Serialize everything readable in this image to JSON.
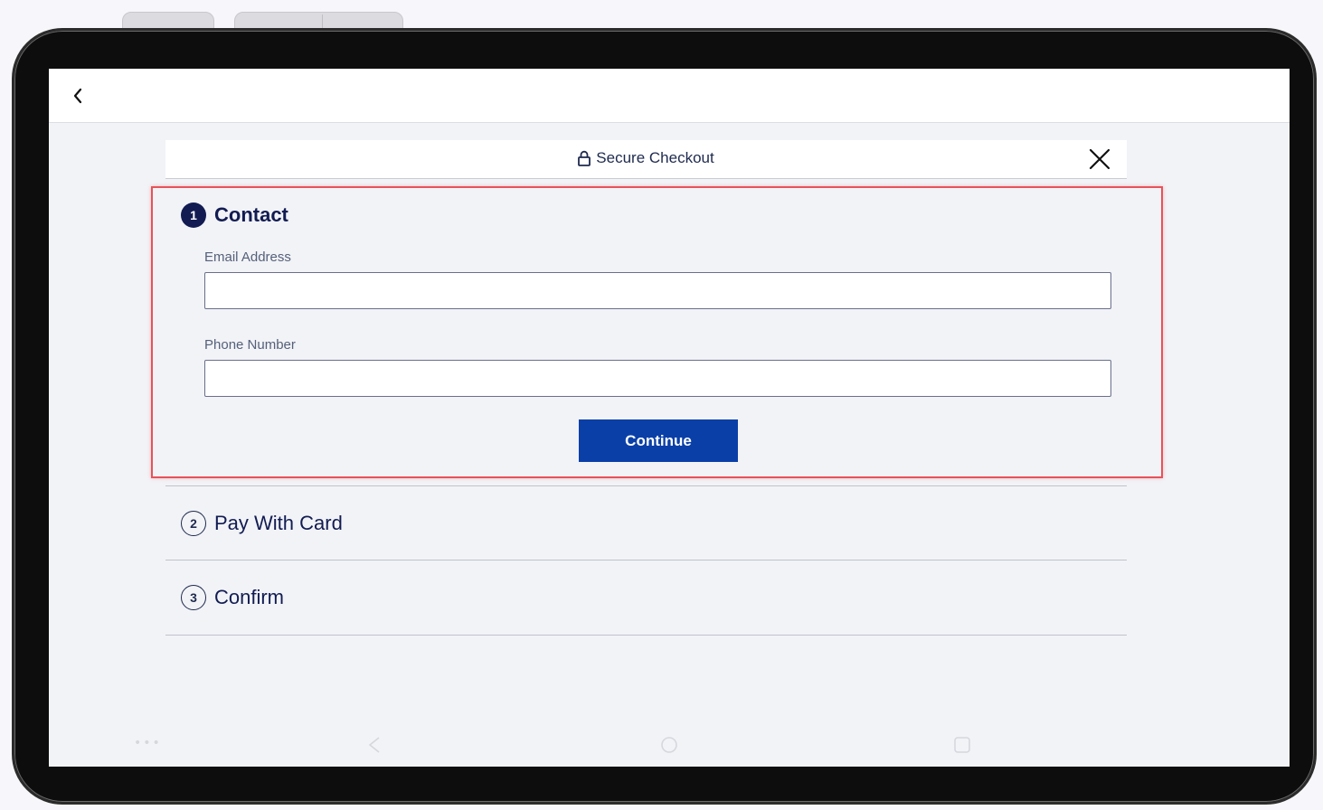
{
  "checkout": {
    "title": "Secure Checkout"
  },
  "steps": [
    {
      "number": "1",
      "label": "Contact",
      "state": "active"
    },
    {
      "number": "2",
      "label": "Pay With Card",
      "state": "inactive"
    },
    {
      "number": "3",
      "label": "Confirm",
      "state": "inactive"
    }
  ],
  "contact_form": {
    "email_label": "Email Address",
    "email_value": "",
    "phone_label": "Phone Number",
    "phone_value": "",
    "continue_label": "Continue"
  },
  "colors": {
    "primary": "#0a3fa8",
    "navy": "#121c52",
    "highlight": "#e8525a",
    "background": "#f2f3f7"
  },
  "icons": {
    "back": "chevron-left-icon",
    "lock": "lock-icon",
    "close": "close-icon"
  }
}
